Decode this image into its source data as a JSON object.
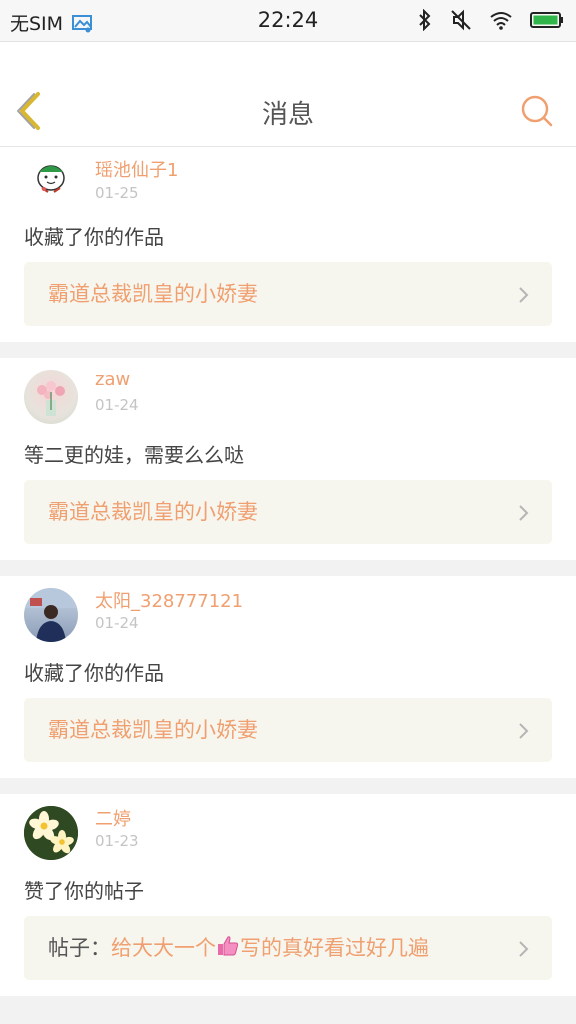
{
  "status_bar": {
    "carrier": "无SIM",
    "time": "22:24",
    "icons": [
      "image-icon",
      "bluetooth-icon",
      "mute-icon",
      "wifi-icon",
      "battery-icon"
    ]
  },
  "header": {
    "title": "消息",
    "back_icon": "chevron-left-icon",
    "search_icon": "search-icon",
    "accent": "#f0a070"
  },
  "messages": [
    {
      "user": "瑶池仙子1",
      "date": "01-25",
      "action": "收藏了你的作品",
      "target": "霸道总裁凯皇的小娇妻"
    },
    {
      "user": "zaw",
      "date": "01-24",
      "action": "等二更的娃，需要么么哒",
      "target": "霸道总裁凯皇的小娇妻"
    },
    {
      "user": "太阳_328777121",
      "date": "01-24",
      "action": "收藏了你的作品",
      "target": "霸道总裁凯皇的小娇妻"
    },
    {
      "user": "二婷",
      "date": "01-23",
      "action": "赞了你的帖子",
      "target_prefix": "帖子：",
      "target_before_emoji": "给大大一个",
      "target_after_emoji": "写的真好看过好几遍",
      "emoji": "thumbs-up-icon"
    }
  ]
}
